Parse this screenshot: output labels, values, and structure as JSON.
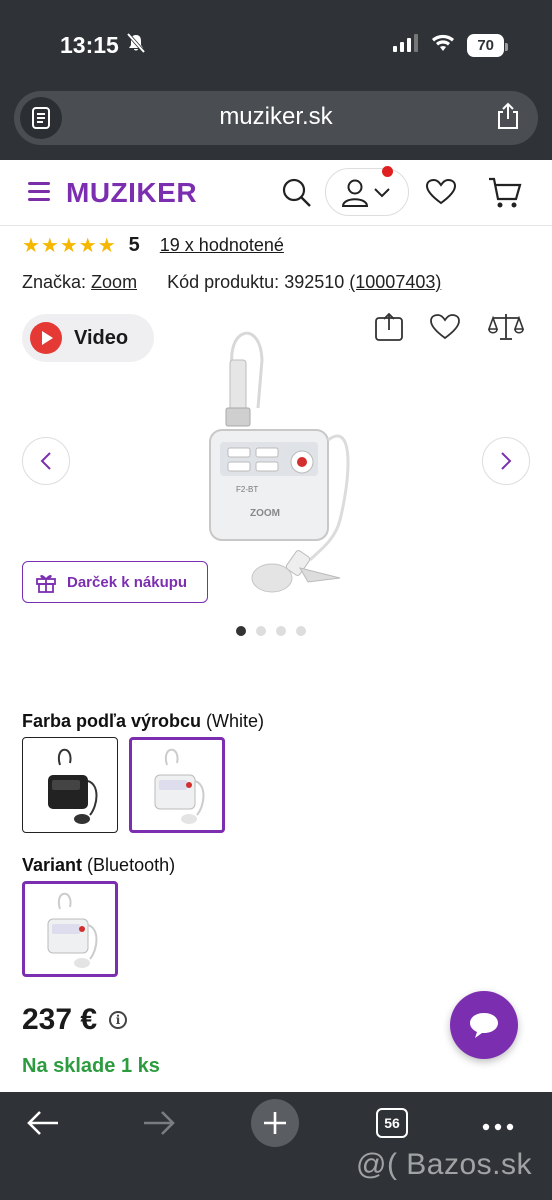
{
  "status_bar": {
    "time": "13:15",
    "battery": "70"
  },
  "browser": {
    "url": "muziker.sk"
  },
  "header": {
    "logo": "MUZIKER"
  },
  "product": {
    "rating_stars": "★★★★★",
    "rating_value": "5",
    "rating_count": "19 x hodnotené",
    "brand_label": "Značka:",
    "brand": "Zoom",
    "code_label": "Kód produktu:",
    "code": "392510",
    "code_extra": "(10007403)",
    "video_label": "Video",
    "gift_label": "Darček k nákupu",
    "gallery_dots": 4,
    "gallery_active": 1
  },
  "options": {
    "color_title": "Farba podľa výrobcu",
    "color_value": "(White)",
    "variant_title": "Variant",
    "variant_value": "(Bluetooth)"
  },
  "price": {
    "amount": "237 €",
    "info_icon": "i"
  },
  "stock": {
    "text": "Na sklade 1 ks"
  },
  "bottom_bar": {
    "tabs_count": "56"
  },
  "watermark": "@( Bazos.sk",
  "colors": {
    "brand": "#7b2fb0",
    "stock_green": "#2c9c3f",
    "star": "#f5b700",
    "chrome": "#2f3236"
  }
}
